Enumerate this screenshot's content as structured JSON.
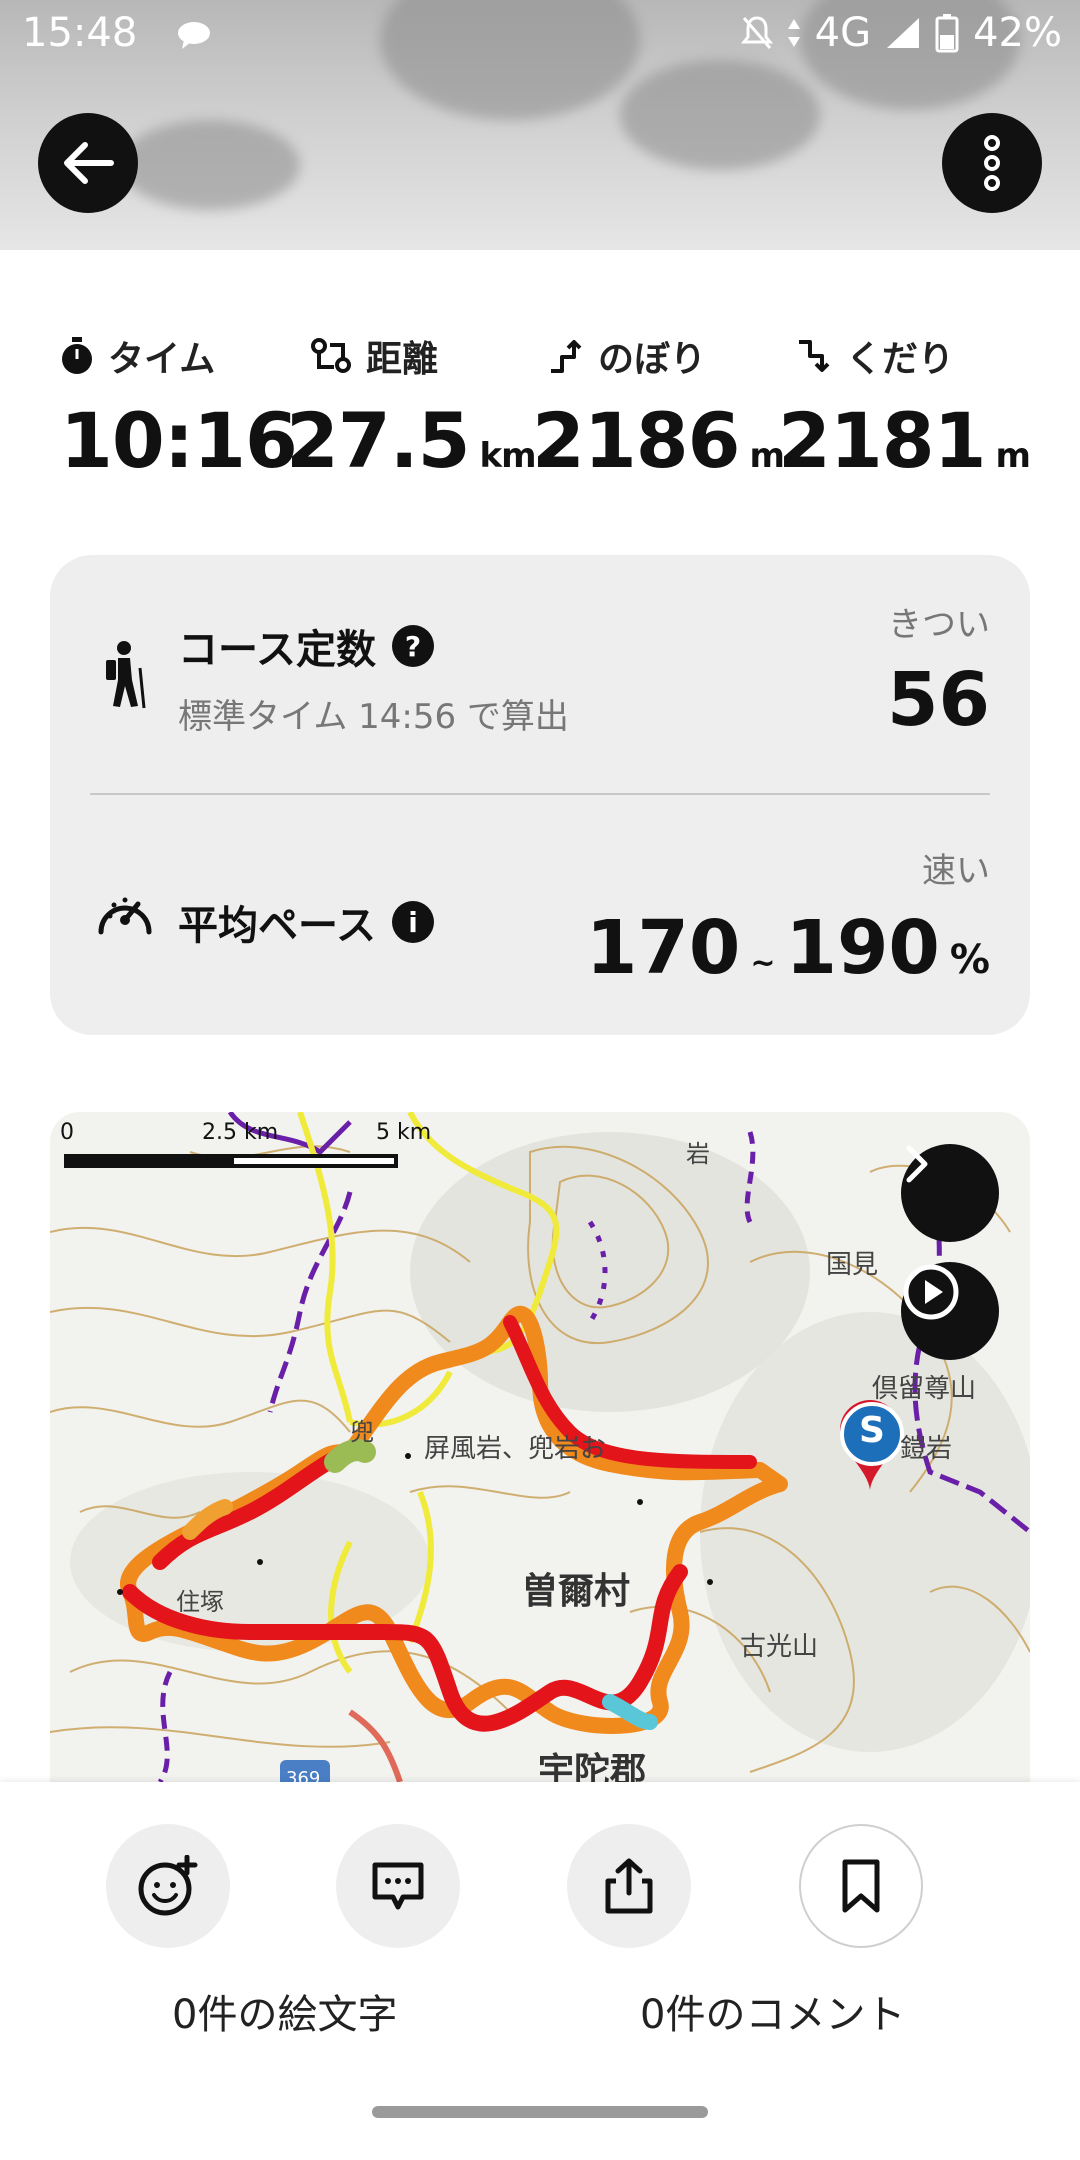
{
  "status_bar": {
    "time": "15:48",
    "network": "4G",
    "battery": "42%"
  },
  "header": {
    "back_icon": "arrow-left-icon",
    "menu_icon": "more-vertical-icon"
  },
  "stats": [
    {
      "label": "タイム",
      "icon": "stopwatch-icon",
      "value": "10:16",
      "unit": ""
    },
    {
      "label": "距離",
      "icon": "route-icon",
      "value": "27.5",
      "unit": "km"
    },
    {
      "label": "のぼり",
      "icon": "ascent-icon",
      "value": "2186",
      "unit": "m"
    },
    {
      "label": "くだり",
      "icon": "descent-icon",
      "value": "2181",
      "unit": "m"
    }
  ],
  "course": {
    "title": "コース定数",
    "subtitle": "標準タイム 14:56 で算出",
    "tag": "きつい",
    "value": "56"
  },
  "pace": {
    "title": "平均ペース",
    "tag": "速い",
    "min": "170",
    "tilde": "~",
    "max": "190",
    "unit": "%"
  },
  "map": {
    "scale": {
      "zero": "0",
      "mid": "2.5 km",
      "max": "5 km"
    },
    "labels": {
      "village": "曽爾村",
      "district": "宇陀郡",
      "peaks": "屏風岩、兜岩お",
      "peak_suffix": "鎧岩",
      "kuchi": "古光山",
      "kaburi": "倶留尊山",
      "kuro": "国見",
      "road": "369",
      "jumi": "住塚",
      "byobu": "屏風岩",
      "kabuto": "兜",
      "iwa": "岩"
    },
    "start_marker": "S"
  },
  "actions": {
    "emoji_count": "0件の絵文字",
    "comment_count": "0件のコメント"
  },
  "colors": {
    "route_red": "#e3151b",
    "route_orange": "#f08a1c",
    "trail_yellow": "#f0ea3b",
    "marker_blue": "#1c6fb8"
  }
}
